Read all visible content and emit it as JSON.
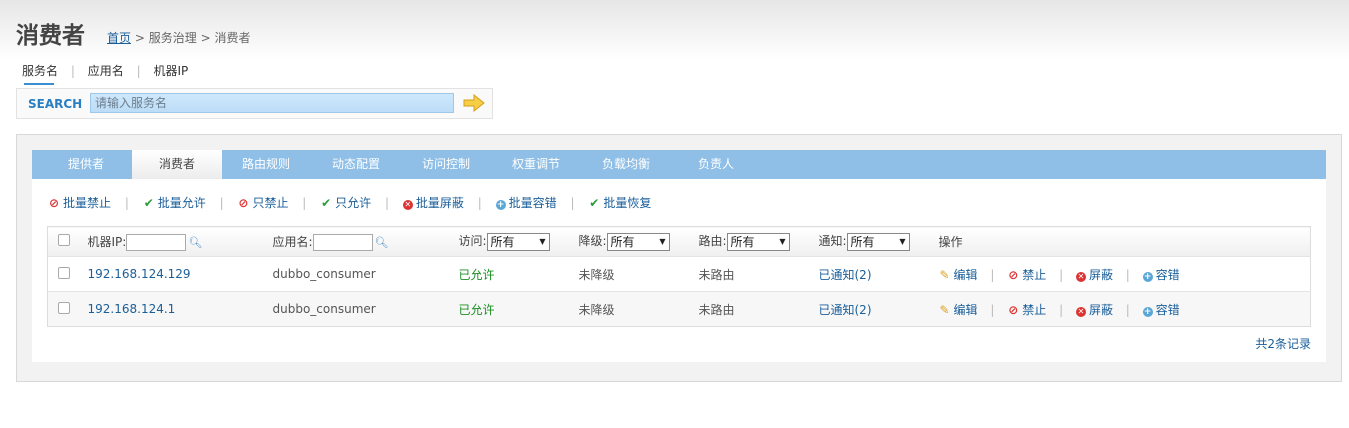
{
  "header": {
    "title": "消费者"
  },
  "breadcrumb": {
    "home": "首页",
    "sep1": ">",
    "parent": "服务治理",
    "sep2": ">",
    "current": "消费者"
  },
  "subnav": {
    "items": [
      "服务名",
      "应用名",
      "机器IP"
    ],
    "separator": "|"
  },
  "search": {
    "label": "SEARCH",
    "placeholder": "请输入服务名"
  },
  "tabs": [
    "提供者",
    "消费者",
    "路由规则",
    "动态配置",
    "访问控制",
    "权重调节",
    "负载均衡",
    "负责人"
  ],
  "actions": [
    "批量禁止",
    "批量允许",
    "只禁止",
    "只允许",
    "批量屏蔽",
    "批量容错",
    "批量恢复"
  ],
  "table": {
    "headers": {
      "ip_label": "机器IP:",
      "app_label": "应用名:",
      "access_label": "访问:",
      "access_value": "所有",
      "degrade_label": "降级:",
      "degrade_value": "所有",
      "route_label": "路由:",
      "route_value": "所有",
      "notify_label": "通知:",
      "notify_value": "所有",
      "ops_label": "操作"
    },
    "rows": [
      {
        "ip": "192.168.124.129",
        "app": "dubbo_consumer",
        "access": "已允许",
        "degrade": "未降级",
        "route": "未路由",
        "notify": "已通知(2)"
      },
      {
        "ip": "192.168.124.1",
        "app": "dubbo_consumer",
        "access": "已允许",
        "degrade": "未降级",
        "route": "未路由",
        "notify": "已通知(2)"
      }
    ],
    "ops": [
      "编辑",
      "禁止",
      "屏蔽",
      "容错"
    ]
  },
  "footer": {
    "count": "共2条记录"
  },
  "colors": {
    "tabbar": "#8fbfe6",
    "link": "#1a5e9a",
    "allowed": "#1b8f23",
    "ban": "#dd3333"
  }
}
